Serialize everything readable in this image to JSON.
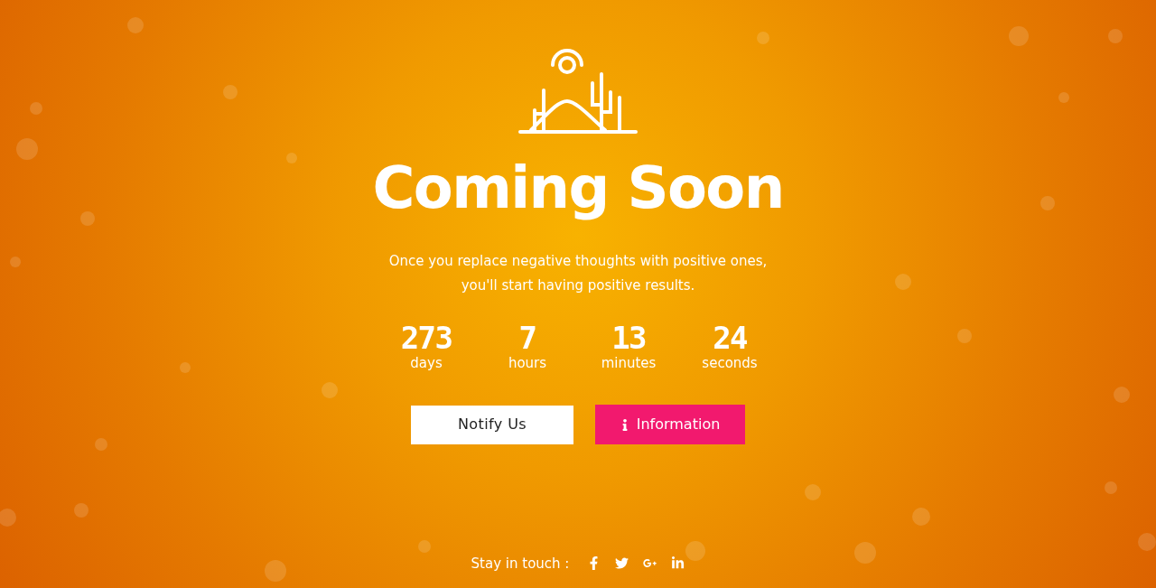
{
  "title": "Coming Soon",
  "tagline_lines": [
    "Once you replace negative thoughts with positive ones,",
    "you'll start having positive results."
  ],
  "countdown": [
    {
      "value": "273",
      "unit": "days"
    },
    {
      "value": "7",
      "unit": "hours"
    },
    {
      "value": "13",
      "unit": "minutes"
    },
    {
      "value": "24",
      "unit": "seconds"
    }
  ],
  "buttons": [
    {
      "kind": "plain",
      "label": "Notify Us"
    },
    {
      "kind": "info",
      "label": "Information"
    }
  ],
  "footer": {
    "label": "Stay in touch :",
    "social": [
      {
        "kind": "facebook"
      },
      {
        "kind": "twitter"
      },
      {
        "kind": "googleplus"
      },
      {
        "kind": "linkedin"
      }
    ]
  }
}
